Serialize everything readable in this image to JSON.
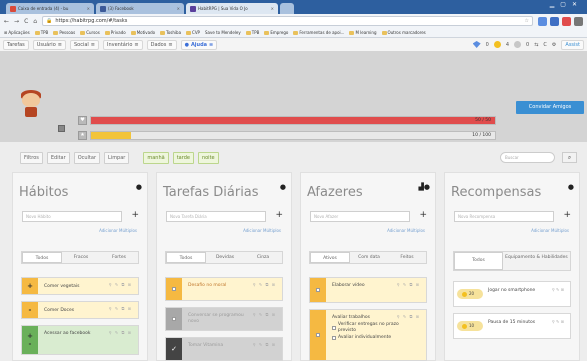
{
  "browser": {
    "tabs": [
      {
        "label": "Caixa de entrada (4) - bu",
        "icon": "gmail-icon"
      },
      {
        "label": "(3) Facebook",
        "icon": "facebook-icon"
      },
      {
        "label": "HabitRPG | Sua Vida O Jo",
        "icon": "habitrpg-icon"
      }
    ],
    "url": "https://habitrpg.com/#/tasks",
    "bookmarks": [
      "Aplicações",
      "TPB",
      "Pessoas",
      "Cursos",
      "Privado",
      "Motivado",
      "Toshiba",
      "CVP",
      "Save to Mendeley",
      "TPB",
      "Emprego",
      "Ferramentas de apoi...",
      "M learning",
      "Outros marcadores"
    ]
  },
  "nav": {
    "items": [
      {
        "label": "Tarefas"
      },
      {
        "label": "Usuário"
      },
      {
        "label": "Social"
      },
      {
        "label": "Inventário"
      },
      {
        "label": "Dados"
      },
      {
        "label": "Ajuda"
      }
    ],
    "gems": "0",
    "gold": "4",
    "silver": "0",
    "assist_label": "Assist"
  },
  "header": {
    "hp_text": "50 / 50",
    "xp_text": "10 / 100",
    "hp_fraction": 1.0,
    "xp_fraction": 0.1,
    "friends_button": "Convidar Amigos",
    "colors": {
      "hp": "#e04c4c",
      "xp": "#f2c43a",
      "header_bg": "#d4d4d4"
    }
  },
  "filters": {
    "buttons": [
      "Filtros",
      "Editar",
      "Ocultar",
      "Limpar"
    ],
    "tags": [
      "manhã",
      "tarde",
      "noite"
    ],
    "search_placeholder": "Buscar"
  },
  "columns": {
    "habits": {
      "title": "Hábitos",
      "placeholder": "Novo Hábito",
      "advanced": "Adicionar Múltiplos",
      "tabs": [
        "Todos",
        "Fracos",
        "Fortes"
      ],
      "items": [
        {
          "text": "Comer vegetais"
        },
        {
          "text": "Comer Doces"
        },
        {
          "text": "Acessar ao facebook"
        }
      ]
    },
    "dailies": {
      "title": "Tarefas Diárias",
      "placeholder": "Nova Tarefa Diária",
      "advanced": "Adicionar Múltiplos",
      "tabs": [
        "Todos",
        "Devidas",
        "Cinza"
      ],
      "items": [
        {
          "text": "Desafio no moral"
        },
        {
          "text": "Conversar se programou novo"
        },
        {
          "text": "Tomar Vitamina"
        }
      ]
    },
    "todos": {
      "title": "Afazeres",
      "placeholder": "Novo Afazer",
      "advanced": "Adicionar Múltiplos",
      "tabs": [
        "Ativos",
        "Com data",
        "Feitos"
      ],
      "items": [
        {
          "text": "Elaborar vídeo"
        },
        {
          "text": "Avaliar trabalhos"
        }
      ],
      "checklist": [
        "Verificar entregas no prazo previsto",
        "Avaliar individualmente"
      ]
    },
    "rewards": {
      "title": "Recompensas",
      "placeholder": "Nova Recompensa",
      "advanced": "Adicionar Múltiplos",
      "tabs": [
        "Todos",
        "Equipamento & Habilidades"
      ],
      "items": [
        {
          "price": "20",
          "text": "Jogar no smartphone"
        },
        {
          "price": "10",
          "text": "Pausa de 15 minutos"
        }
      ]
    }
  }
}
